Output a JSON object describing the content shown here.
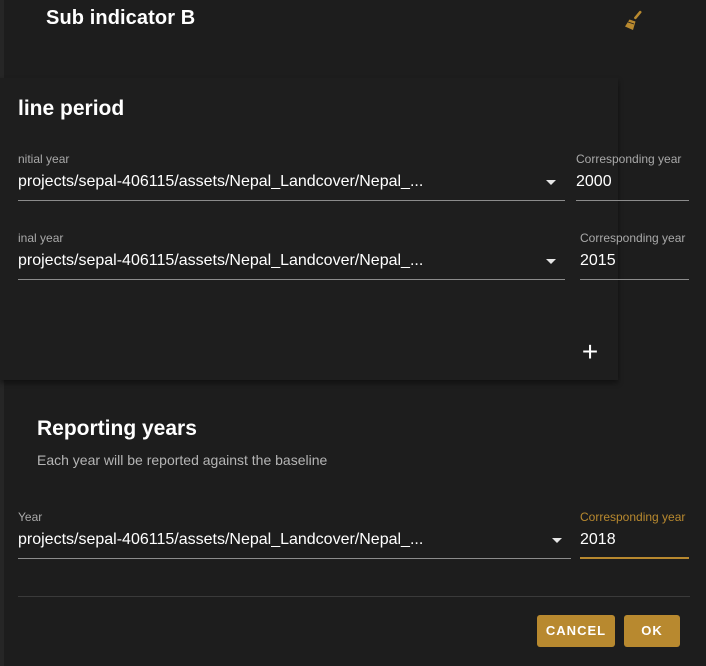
{
  "dialog": {
    "title": "Sub indicator B"
  },
  "baseline": {
    "heading": "line period",
    "initial": {
      "label": "nitial year",
      "value": "projects/sepal-406115/assets/Nepal_Landcover/Nepal_...",
      "year_label": "Corresponding year",
      "year_value": "2000"
    },
    "final": {
      "label": "inal year",
      "value": "projects/sepal-406115/assets/Nepal_Landcover/Nepal_...",
      "year_label": "Corresponding year",
      "year_value": "2015"
    },
    "add_label": "+"
  },
  "reporting": {
    "heading": "Reporting years",
    "subtitle": "Each year will be reported against the baseline",
    "year": {
      "label": "Year",
      "value": "projects/sepal-406115/assets/Nepal_Landcover/Nepal_...",
      "year_label": "Corresponding year",
      "year_value": "2018"
    }
  },
  "actions": {
    "cancel_label": "CANCEL",
    "ok_label": "OK"
  },
  "colors": {
    "accent": "#b8892f",
    "background": "#1d1d1d"
  },
  "icons": {
    "clear": "broom-icon",
    "dropdown": "caret-down-icon",
    "add": "plus-icon"
  }
}
